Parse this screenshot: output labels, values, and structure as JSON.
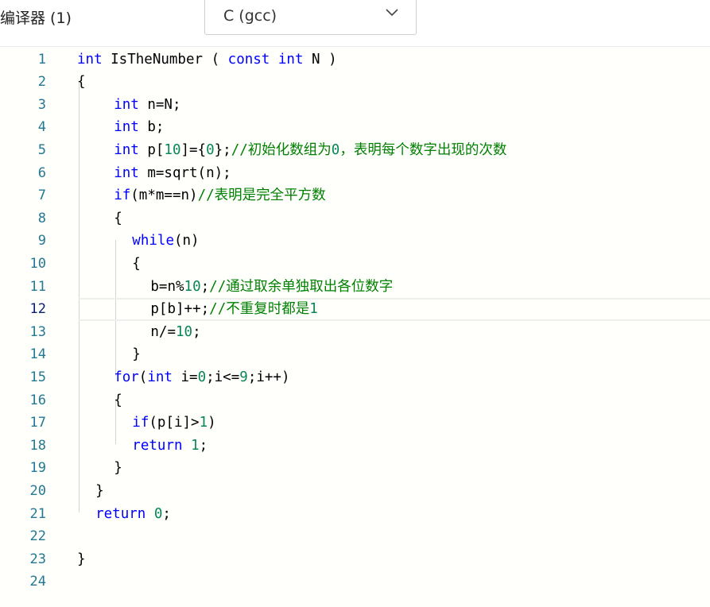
{
  "toolbar": {
    "compiler_label": "编译器 (1)",
    "language_selected": "C (gcc)",
    "chevron_icon": "chevron-down-icon"
  },
  "editor": {
    "active_line": 12,
    "colors": {
      "keyword": "#0000ff",
      "number": "#098658",
      "comment": "#008000",
      "line_number": "#237893"
    },
    "lines": [
      {
        "n": "1",
        "indent": 0,
        "tokens": [
          [
            "kw",
            "int"
          ],
          [
            "t",
            " IsTheNumber ( "
          ],
          [
            "kw",
            "const"
          ],
          [
            "t",
            " "
          ],
          [
            "kw",
            "int"
          ],
          [
            "t",
            " N )"
          ]
        ]
      },
      {
        "n": "2",
        "indent": 0,
        "tokens": [
          [
            "t",
            "{"
          ]
        ]
      },
      {
        "n": "3",
        "indent": 4,
        "tokens": [
          [
            "kw",
            "int"
          ],
          [
            "t",
            " n=N;"
          ]
        ]
      },
      {
        "n": "4",
        "indent": 4,
        "tokens": [
          [
            "kw",
            "int"
          ],
          [
            "t",
            " b;"
          ]
        ]
      },
      {
        "n": "5",
        "indent": 4,
        "tokens": [
          [
            "kw",
            "int"
          ],
          [
            "t",
            " p["
          ],
          [
            "num",
            "10"
          ],
          [
            "t",
            "]={"
          ],
          [
            "num",
            "0"
          ],
          [
            "t",
            "};"
          ],
          [
            "cm",
            "//初始化数组为"
          ],
          [
            "num",
            "0"
          ],
          [
            "cm",
            "，表明每个数字出现的次数"
          ]
        ]
      },
      {
        "n": "6",
        "indent": 4,
        "tokens": [
          [
            "kw",
            "int"
          ],
          [
            "t",
            " m=sqrt(n);"
          ]
        ]
      },
      {
        "n": "7",
        "indent": 4,
        "tokens": [
          [
            "kw",
            "if"
          ],
          [
            "t",
            "(m*m==n)"
          ],
          [
            "cm",
            "//表明是完全平方数"
          ]
        ]
      },
      {
        "n": "8",
        "indent": 4,
        "tokens": [
          [
            "t",
            "{"
          ]
        ]
      },
      {
        "n": "9",
        "indent": 6,
        "tokens": [
          [
            "kw",
            "while"
          ],
          [
            "t",
            "(n)"
          ]
        ]
      },
      {
        "n": "10",
        "indent": 6,
        "tokens": [
          [
            "t",
            "{"
          ]
        ]
      },
      {
        "n": "11",
        "indent": 8,
        "tokens": [
          [
            "t",
            "b=n%"
          ],
          [
            "num",
            "10"
          ],
          [
            "t",
            ";"
          ],
          [
            "cm",
            "//通过取余单独取出各位数字"
          ]
        ]
      },
      {
        "n": "12",
        "indent": 8,
        "tokens": [
          [
            "t",
            "p[b]++;"
          ],
          [
            "cm",
            "//不重复时都是"
          ],
          [
            "num",
            "1"
          ]
        ]
      },
      {
        "n": "13",
        "indent": 8,
        "tokens": [
          [
            "t",
            "n/="
          ],
          [
            "num",
            "10"
          ],
          [
            "t",
            ";"
          ]
        ]
      },
      {
        "n": "14",
        "indent": 6,
        "tokens": [
          [
            "t",
            "}"
          ]
        ]
      },
      {
        "n": "15",
        "indent": 4,
        "tokens": [
          [
            "kw",
            "for"
          ],
          [
            "t",
            "("
          ],
          [
            "kw",
            "int"
          ],
          [
            "t",
            " i="
          ],
          [
            "num",
            "0"
          ],
          [
            "t",
            ";i<="
          ],
          [
            "num",
            "9"
          ],
          [
            "t",
            ";i++)"
          ]
        ]
      },
      {
        "n": "16",
        "indent": 4,
        "tokens": [
          [
            "t",
            "{"
          ]
        ]
      },
      {
        "n": "17",
        "indent": 6,
        "tokens": [
          [
            "kw",
            "if"
          ],
          [
            "t",
            "(p[i]>"
          ],
          [
            "num",
            "1"
          ],
          [
            "t",
            ")"
          ]
        ]
      },
      {
        "n": "18",
        "indent": 6,
        "tokens": [
          [
            "kw",
            "return"
          ],
          [
            "t",
            " "
          ],
          [
            "num",
            "1"
          ],
          [
            "t",
            ";"
          ]
        ]
      },
      {
        "n": "19",
        "indent": 4,
        "tokens": [
          [
            "t",
            "}"
          ]
        ]
      },
      {
        "n": "20",
        "indent": 2,
        "tokens": [
          [
            "t",
            "}"
          ]
        ]
      },
      {
        "n": "21",
        "indent": 2,
        "tokens": [
          [
            "kw",
            "return"
          ],
          [
            "t",
            " "
          ],
          [
            "num",
            "0"
          ],
          [
            "t",
            ";"
          ]
        ]
      },
      {
        "n": "22",
        "indent": 0,
        "tokens": []
      },
      {
        "n": "23",
        "indent": 0,
        "tokens": [
          [
            "t",
            "}"
          ]
        ]
      },
      {
        "n": "24",
        "indent": 0,
        "tokens": []
      }
    ]
  }
}
